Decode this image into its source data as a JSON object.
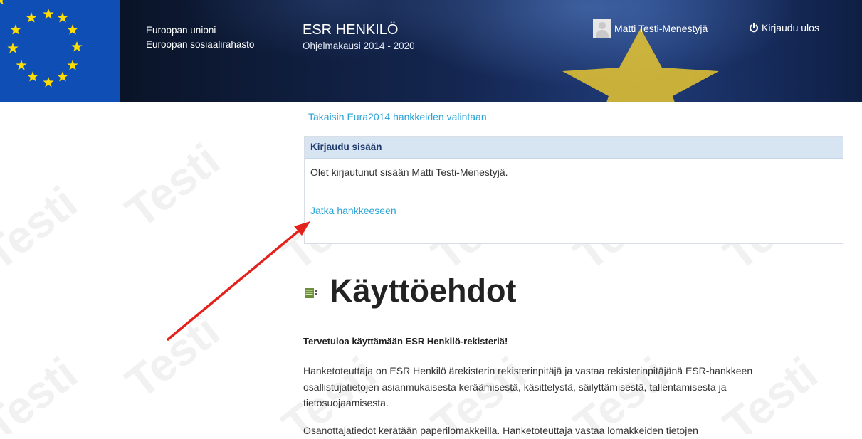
{
  "header": {
    "eu_line1": "Euroopan unioni",
    "eu_line2": "Euroopan sosiaalirahasto",
    "app_title": "ESR HENKILÖ",
    "app_subtitle": "Ohjelmakausi 2014 - 2020",
    "user_name": "Matti Testi-Menestyjä",
    "logout_label": "Kirjaudu ulos",
    "icons": {
      "flag": "eu-flag-icon",
      "avatar": "user-avatar-icon",
      "logout": "power-icon"
    }
  },
  "watermark_text": "Testi",
  "main": {
    "back_link": "Takaisin Eura2014 hankkeiden valintaan",
    "login_panel": {
      "heading": "Kirjaudu sisään",
      "message": "Olet kirjautunut sisään Matti Testi-Menestyjä.",
      "continue_link": "Jatka hankkeeseen"
    },
    "title": "Käyttöehdot",
    "welcome": "Tervetuloa käyttämään ESR Henkilö-rekisteriä!",
    "paragraph1": "Hanketoteuttaja on ESR Henkilö ärekisterin rekisterinpitäjä ja vastaa rekisterinpitäjänä ESR-hankkeen osallistujatietojen asianmukaisesta keräämisestä, käsittelystä, säilyttämisestä, tallentamisesta ja tietosuojaamisesta.",
    "paragraph2": "Osanottajatiedot kerätään paperilomakkeilla. Hanketoteuttaja vastaa lomakkeiden tietojen"
  },
  "colors": {
    "link": "#2aa3d8",
    "panel_header": "#d7e4f2",
    "header_bg": "#0e1b3a",
    "flag_blue": "#0f4fb5",
    "star_yellow": "#ffdd00",
    "arrow_red": "#e3221b"
  }
}
